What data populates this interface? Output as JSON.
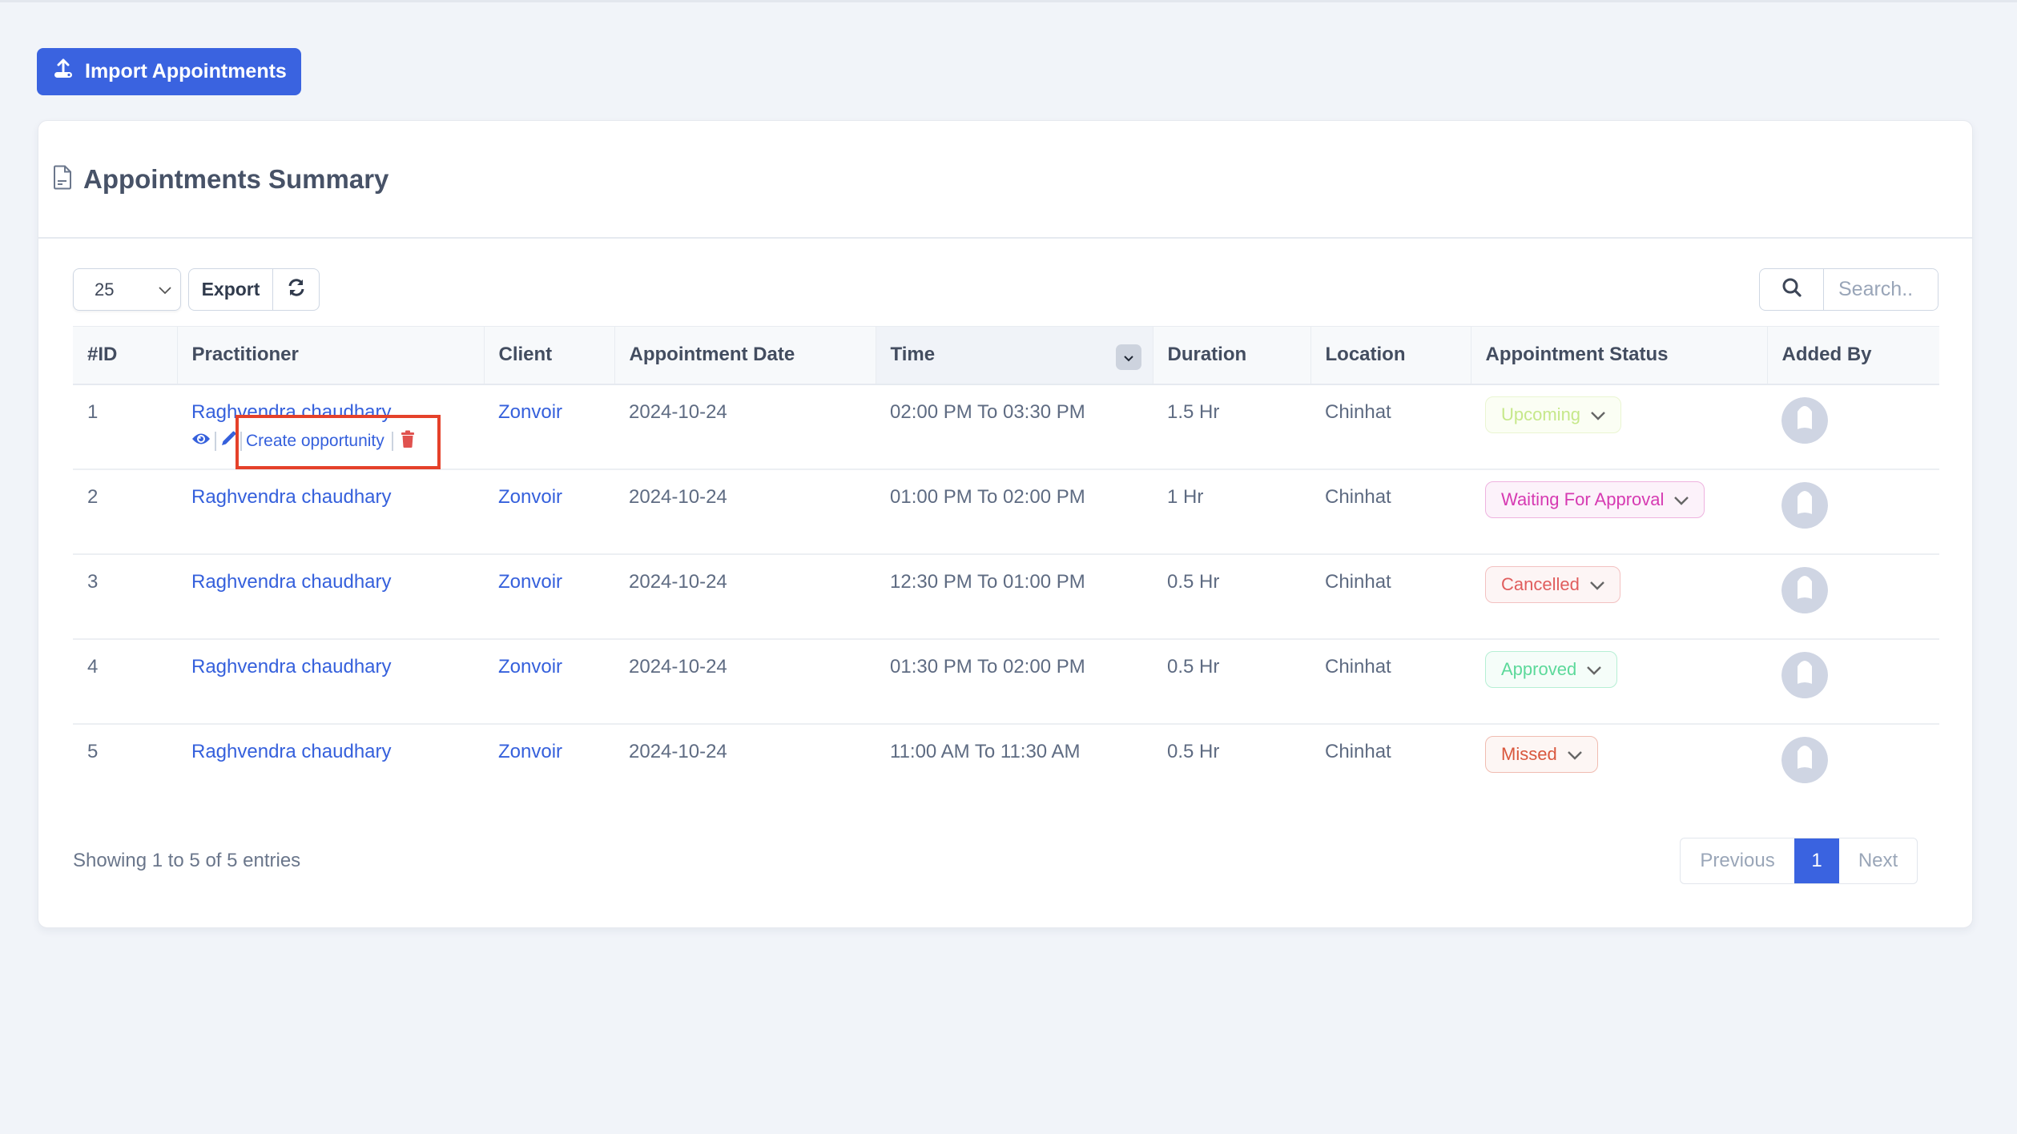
{
  "import_button": {
    "label": "Import Appointments",
    "icon": "upload-icon"
  },
  "card": {
    "title": "Appointments Summary",
    "icon": "document-icon"
  },
  "toolbar": {
    "page_size": "25",
    "export_label": "Export",
    "refresh_icon": "refresh-icon",
    "search_placeholder": "Search..",
    "search_value": ""
  },
  "table": {
    "columns": [
      "#ID",
      "Practitioner",
      "Client",
      "Appointment Date",
      "Time",
      "Duration",
      "Location",
      "Appointment Status",
      "Added By"
    ],
    "sorted_column": "Time",
    "rows": [
      {
        "id": "1",
        "practitioner": "Raghvendra chaudhary",
        "client": "Zonvoir",
        "date": "2024-10-24",
        "time": "02:00 PM To 03:30 PM",
        "duration": "1.5 Hr",
        "location": "Chinhat",
        "status": "Upcoming",
        "status_color": "#c6e88a",
        "status_bg": "#fbfef4",
        "status_border": "#eaf5d2"
      },
      {
        "id": "2",
        "practitioner": "Raghvendra chaudhary",
        "client": "Zonvoir",
        "date": "2024-10-24",
        "time": "01:00 PM To 02:00 PM",
        "duration": "1 Hr",
        "location": "Chinhat",
        "status": "Waiting For Approval",
        "status_color": "#d63ab2",
        "status_bg": "#fcf2fa",
        "status_border": "#eeb3df"
      },
      {
        "id": "3",
        "practitioner": "Raghvendra chaudhary",
        "client": "Zonvoir",
        "date": "2024-10-24",
        "time": "12:30 PM To 01:00 PM",
        "duration": "0.5 Hr",
        "location": "Chinhat",
        "status": "Cancelled",
        "status_color": "#e05d5d",
        "status_bg": "#fdf5f5",
        "status_border": "#f3c1c1"
      },
      {
        "id": "4",
        "practitioner": "Raghvendra chaudhary",
        "client": "Zonvoir",
        "date": "2024-10-24",
        "time": "01:30 PM To 02:00 PM",
        "duration": "0.5 Hr",
        "location": "Chinhat",
        "status": "Approved",
        "status_color": "#5cd99a",
        "status_bg": "#f5fdf9",
        "status_border": "#b6efd4"
      },
      {
        "id": "5",
        "practitioner": "Raghvendra chaudhary",
        "client": "Zonvoir",
        "date": "2024-10-24",
        "time": "11:00 AM To 11:30 AM",
        "duration": "0.5 Hr",
        "location": "Chinhat",
        "status": "Missed",
        "status_color": "#d9573d",
        "status_bg": "#fdf6f4",
        "status_border": "#f0bcb1"
      }
    ],
    "row_actions": {
      "view_icon": "eye-icon",
      "edit_icon": "pencil-icon",
      "create_label": "Create opportunity",
      "delete_icon": "trash-icon"
    }
  },
  "footer": {
    "summary": "Showing 1 to 5 of 5 entries",
    "pagination": {
      "previous": "Previous",
      "current": "1",
      "next": "Next"
    }
  },
  "colors": {
    "primary": "#3a63e0",
    "highlight": "#e5412a",
    "danger": "#e0524f"
  }
}
